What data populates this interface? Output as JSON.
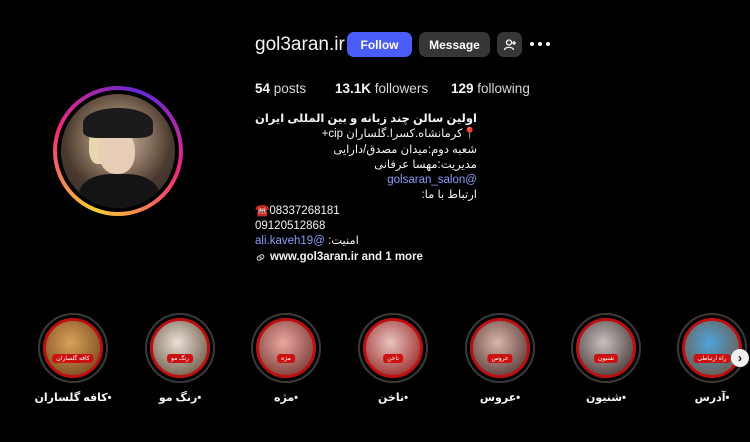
{
  "profile": {
    "username": "gol3aran.ir",
    "follow_label": "Follow",
    "message_label": "Message",
    "stats": {
      "posts_count": "54",
      "posts_label": "posts",
      "followers_count": "13.1K",
      "followers_label": "followers",
      "following_count": "129",
      "following_label": "following"
    },
    "bio": {
      "name": "اولین سالن چند زبانه و بین المللی ایران",
      "line1": "📍کرمانشاه.کسرا.گلساران cip+",
      "line2": "شعبه دوم:میدان مصدق/دارایی",
      "line3": "مدیریت:مهسا عرفانی",
      "mention1": "@golsaran_salon",
      "line4": "ارتباط با ما:",
      "phone1": "☎️08337268181",
      "phone2": "09120512868",
      "line5_text": "امنیت: ",
      "line5_mention": "@ali.kaveh19",
      "website": "www.gol3aran.ir and 1 more"
    }
  },
  "highlights": [
    {
      "label": "•کافه گلساران",
      "tag": "کافه گلساران",
      "colors": [
        "#d9a35c",
        "#7a4a1e"
      ]
    },
    {
      "label": "•رنگ مو",
      "tag": "رنگ مو",
      "colors": [
        "#e9e1d6",
        "#6d5a49"
      ]
    },
    {
      "label": "•مژه",
      "tag": "مژه",
      "colors": [
        "#e9a9a0",
        "#7a3a35"
      ]
    },
    {
      "label": "•ناخن",
      "tag": "ناخن",
      "colors": [
        "#e8c5c0",
        "#9a2a2a"
      ]
    },
    {
      "label": "•عروس",
      "tag": "عروس",
      "colors": [
        "#d8b7a8",
        "#5a3a3a"
      ]
    },
    {
      "label": "•شنیون",
      "tag": "شنیون",
      "colors": [
        "#c8c0c0",
        "#4a3a3a"
      ]
    },
    {
      "label": "•آدرس",
      "tag": "راه ارتباطی",
      "colors": [
        "#4fa3d9",
        "#6b5a4a"
      ]
    }
  ],
  "icons": {
    "add_user": "person-add-icon",
    "more": "more-dots-icon",
    "link": "link-icon",
    "next": "chevron-right-icon"
  }
}
